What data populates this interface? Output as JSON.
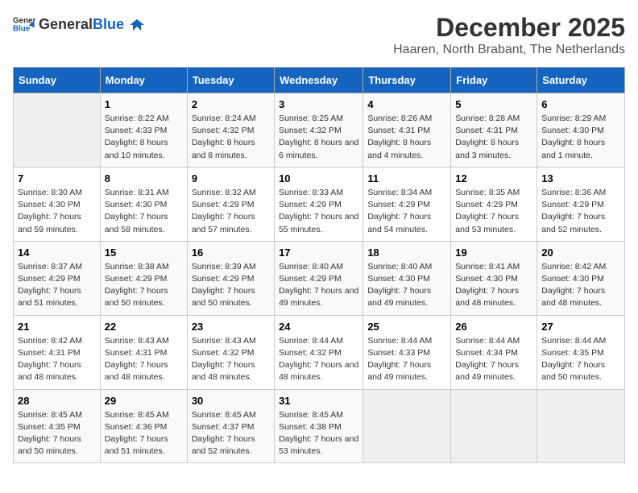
{
  "header": {
    "logo_general": "General",
    "logo_blue": "Blue",
    "month": "December 2025",
    "location": "Haaren, North Brabant, The Netherlands"
  },
  "weekdays": [
    "Sunday",
    "Monday",
    "Tuesday",
    "Wednesday",
    "Thursday",
    "Friday",
    "Saturday"
  ],
  "weeks": [
    [
      {
        "day": "",
        "empty": true
      },
      {
        "day": "1",
        "sunrise": "Sunrise: 8:22 AM",
        "sunset": "Sunset: 4:33 PM",
        "daylight": "Daylight: 8 hours and 10 minutes."
      },
      {
        "day": "2",
        "sunrise": "Sunrise: 8:24 AM",
        "sunset": "Sunset: 4:32 PM",
        "daylight": "Daylight: 8 hours and 8 minutes."
      },
      {
        "day": "3",
        "sunrise": "Sunrise: 8:25 AM",
        "sunset": "Sunset: 4:32 PM",
        "daylight": "Daylight: 8 hours and 6 minutes."
      },
      {
        "day": "4",
        "sunrise": "Sunrise: 8:26 AM",
        "sunset": "Sunset: 4:31 PM",
        "daylight": "Daylight: 8 hours and 4 minutes."
      },
      {
        "day": "5",
        "sunrise": "Sunrise: 8:28 AM",
        "sunset": "Sunset: 4:31 PM",
        "daylight": "Daylight: 8 hours and 3 minutes."
      },
      {
        "day": "6",
        "sunrise": "Sunrise: 8:29 AM",
        "sunset": "Sunset: 4:30 PM",
        "daylight": "Daylight: 8 hours and 1 minute."
      }
    ],
    [
      {
        "day": "7",
        "sunrise": "Sunrise: 8:30 AM",
        "sunset": "Sunset: 4:30 PM",
        "daylight": "Daylight: 7 hours and 59 minutes."
      },
      {
        "day": "8",
        "sunrise": "Sunrise: 8:31 AM",
        "sunset": "Sunset: 4:30 PM",
        "daylight": "Daylight: 7 hours and 58 minutes."
      },
      {
        "day": "9",
        "sunrise": "Sunrise: 8:32 AM",
        "sunset": "Sunset: 4:29 PM",
        "daylight": "Daylight: 7 hours and 57 minutes."
      },
      {
        "day": "10",
        "sunrise": "Sunrise: 8:33 AM",
        "sunset": "Sunset: 4:29 PM",
        "daylight": "Daylight: 7 hours and 55 minutes."
      },
      {
        "day": "11",
        "sunrise": "Sunrise: 8:34 AM",
        "sunset": "Sunset: 4:29 PM",
        "daylight": "Daylight: 7 hours and 54 minutes."
      },
      {
        "day": "12",
        "sunrise": "Sunrise: 8:35 AM",
        "sunset": "Sunset: 4:29 PM",
        "daylight": "Daylight: 7 hours and 53 minutes."
      },
      {
        "day": "13",
        "sunrise": "Sunrise: 8:36 AM",
        "sunset": "Sunset: 4:29 PM",
        "daylight": "Daylight: 7 hours and 52 minutes."
      }
    ],
    [
      {
        "day": "14",
        "sunrise": "Sunrise: 8:37 AM",
        "sunset": "Sunset: 4:29 PM",
        "daylight": "Daylight: 7 hours and 51 minutes."
      },
      {
        "day": "15",
        "sunrise": "Sunrise: 8:38 AM",
        "sunset": "Sunset: 4:29 PM",
        "daylight": "Daylight: 7 hours and 50 minutes."
      },
      {
        "day": "16",
        "sunrise": "Sunrise: 8:39 AM",
        "sunset": "Sunset: 4:29 PM",
        "daylight": "Daylight: 7 hours and 50 minutes."
      },
      {
        "day": "17",
        "sunrise": "Sunrise: 8:40 AM",
        "sunset": "Sunset: 4:29 PM",
        "daylight": "Daylight: 7 hours and 49 minutes."
      },
      {
        "day": "18",
        "sunrise": "Sunrise: 8:40 AM",
        "sunset": "Sunset: 4:30 PM",
        "daylight": "Daylight: 7 hours and 49 minutes."
      },
      {
        "day": "19",
        "sunrise": "Sunrise: 8:41 AM",
        "sunset": "Sunset: 4:30 PM",
        "daylight": "Daylight: 7 hours and 48 minutes."
      },
      {
        "day": "20",
        "sunrise": "Sunrise: 8:42 AM",
        "sunset": "Sunset: 4:30 PM",
        "daylight": "Daylight: 7 hours and 48 minutes."
      }
    ],
    [
      {
        "day": "21",
        "sunrise": "Sunrise: 8:42 AM",
        "sunset": "Sunset: 4:31 PM",
        "daylight": "Daylight: 7 hours and 48 minutes."
      },
      {
        "day": "22",
        "sunrise": "Sunrise: 8:43 AM",
        "sunset": "Sunset: 4:31 PM",
        "daylight": "Daylight: 7 hours and 48 minutes."
      },
      {
        "day": "23",
        "sunrise": "Sunrise: 8:43 AM",
        "sunset": "Sunset: 4:32 PM",
        "daylight": "Daylight: 7 hours and 48 minutes."
      },
      {
        "day": "24",
        "sunrise": "Sunrise: 8:44 AM",
        "sunset": "Sunset: 4:32 PM",
        "daylight": "Daylight: 7 hours and 48 minutes."
      },
      {
        "day": "25",
        "sunrise": "Sunrise: 8:44 AM",
        "sunset": "Sunset: 4:33 PM",
        "daylight": "Daylight: 7 hours and 49 minutes."
      },
      {
        "day": "26",
        "sunrise": "Sunrise: 8:44 AM",
        "sunset": "Sunset: 4:34 PM",
        "daylight": "Daylight: 7 hours and 49 minutes."
      },
      {
        "day": "27",
        "sunrise": "Sunrise: 8:44 AM",
        "sunset": "Sunset: 4:35 PM",
        "daylight": "Daylight: 7 hours and 50 minutes."
      }
    ],
    [
      {
        "day": "28",
        "sunrise": "Sunrise: 8:45 AM",
        "sunset": "Sunset: 4:35 PM",
        "daylight": "Daylight: 7 hours and 50 minutes."
      },
      {
        "day": "29",
        "sunrise": "Sunrise: 8:45 AM",
        "sunset": "Sunset: 4:36 PM",
        "daylight": "Daylight: 7 hours and 51 minutes."
      },
      {
        "day": "30",
        "sunrise": "Sunrise: 8:45 AM",
        "sunset": "Sunset: 4:37 PM",
        "daylight": "Daylight: 7 hours and 52 minutes."
      },
      {
        "day": "31",
        "sunrise": "Sunrise: 8:45 AM",
        "sunset": "Sunset: 4:38 PM",
        "daylight": "Daylight: 7 hours and 53 minutes."
      },
      {
        "day": "",
        "empty": true
      },
      {
        "day": "",
        "empty": true
      },
      {
        "day": "",
        "empty": true
      }
    ]
  ]
}
